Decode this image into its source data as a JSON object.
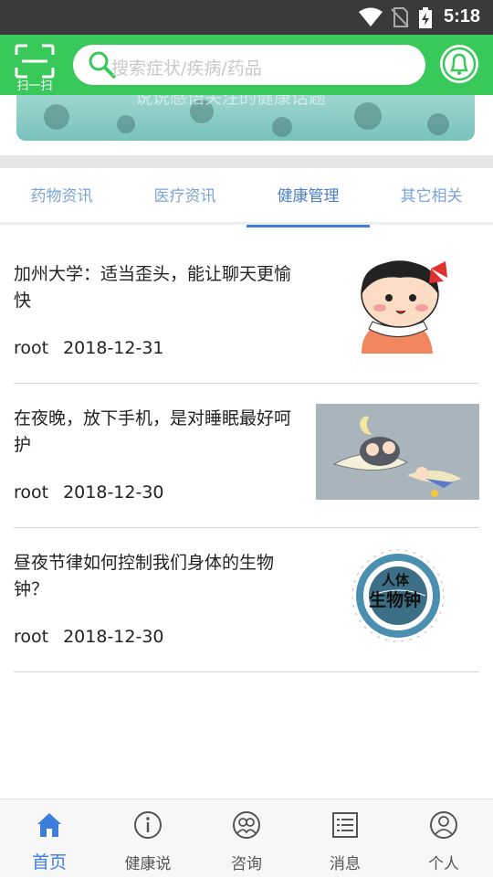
{
  "status_bar": {
    "time": "5:18"
  },
  "header": {
    "scan_label": "扫一扫",
    "search_placeholder": "搜索症状/疾病/药品"
  },
  "banner": {
    "overlay_text": "说说感悟关注的健康话题"
  },
  "tabs": [
    {
      "label": "药物资讯",
      "active": false
    },
    {
      "label": "医疗资讯",
      "active": false
    },
    {
      "label": "健康管理",
      "active": true
    },
    {
      "label": "其它相关",
      "active": false
    }
  ],
  "articles": [
    {
      "title": "加州大学：适当歪头，能让聊天更愉快",
      "author": "root",
      "date": "2018-12-31",
      "thumb": "cartoon-girl-image"
    },
    {
      "title": "在夜晚，放下手机，是对睡眠最好呵护",
      "author": "root",
      "date": "2018-12-30",
      "thumb": "sleeping-illustration-image"
    },
    {
      "title": "昼夜节律如何控制我们身体的生物钟？",
      "author": "root",
      "date": "2018-12-30",
      "thumb": "body-clock-diagram-image",
      "thumb_text": [
        "人体",
        "生物钟"
      ]
    }
  ],
  "bottom_nav": [
    {
      "label": "首页",
      "icon": "home-icon",
      "active": true
    },
    {
      "label": "健康说",
      "icon": "info-icon",
      "active": false
    },
    {
      "label": "咨询",
      "icon": "consult-icon",
      "active": false
    },
    {
      "label": "消息",
      "icon": "message-list-icon",
      "active": false
    },
    {
      "label": "个人",
      "icon": "person-icon",
      "active": false
    }
  ],
  "colors": {
    "header_green": "#38c95a",
    "accent_blue": "#3d7ddb",
    "tab_text": "#7aa4d8"
  }
}
